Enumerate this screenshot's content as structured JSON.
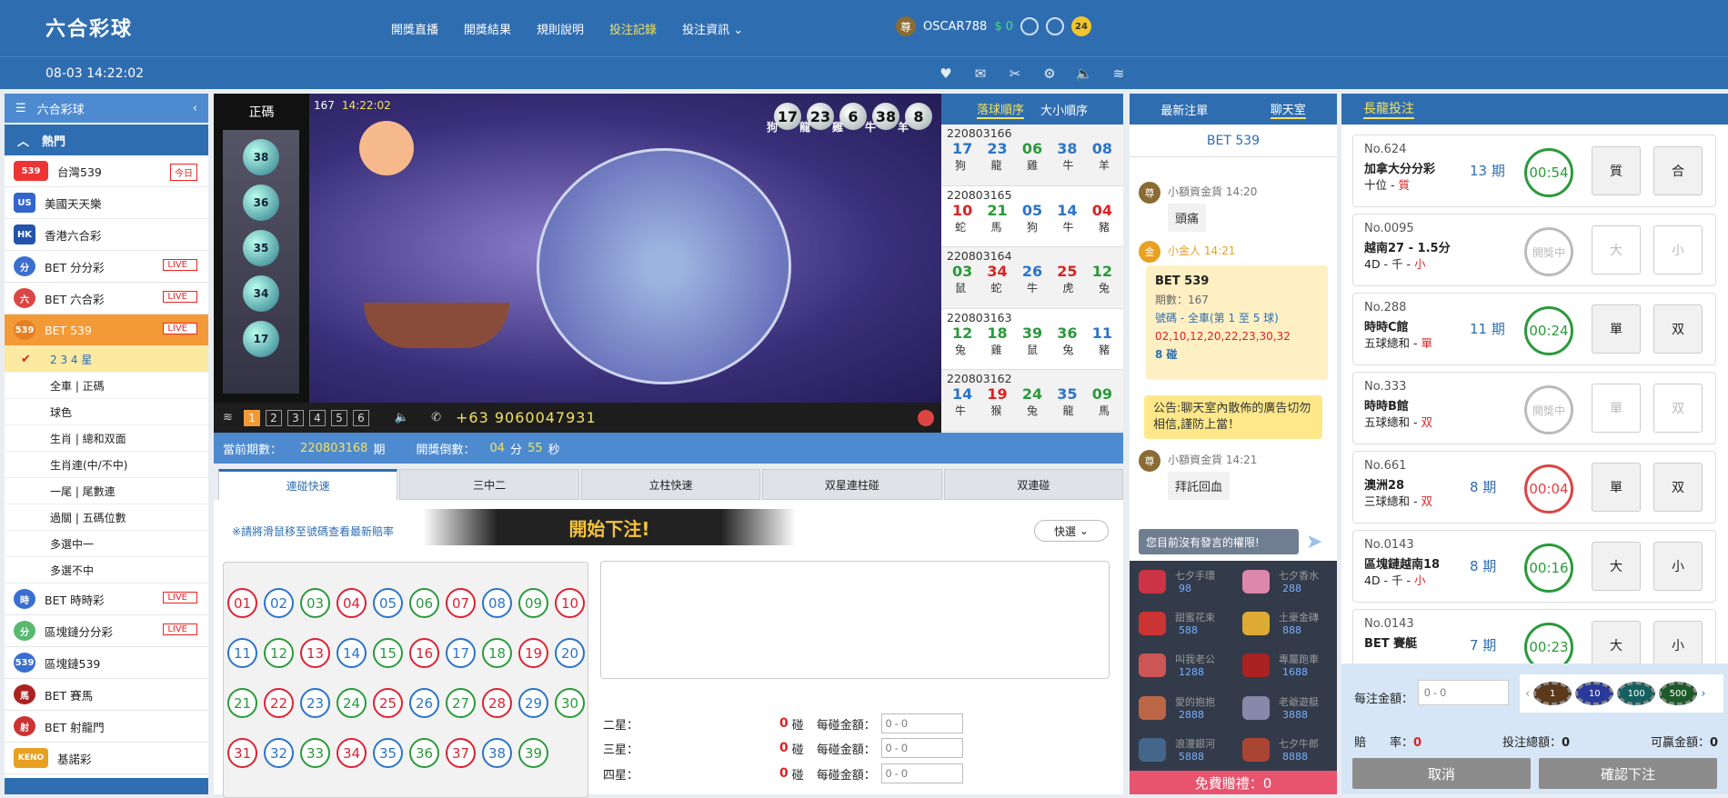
{
  "header": {
    "logo": "六合彩球",
    "nav": [
      "開獎直播",
      "開獎結果",
      "規則說明",
      "投注記錄",
      "投注資訊"
    ],
    "active_nav": 3,
    "avatar": "尊",
    "username": "OSCAR788",
    "balance": "$ 0",
    "badge": "24"
  },
  "subbar": {
    "datetime": "08-03 14:22:02"
  },
  "sidebar": {
    "title": "六合彩球",
    "hot": "熱門",
    "items": [
      {
        "label": "台灣539",
        "icon": "539",
        "tag": "今日"
      },
      {
        "label": "美國天天樂",
        "icon": "US"
      },
      {
        "label": "香港六合彩",
        "icon": "HK"
      },
      {
        "label": "BET 分分彩",
        "icon": "分",
        "live": "LIVE"
      },
      {
        "label": "BET 六合彩",
        "icon": "六",
        "live": "LIVE"
      },
      {
        "label": "BET 539",
        "icon": "539",
        "live": "LIVE"
      }
    ],
    "subitems": [
      "2 3 4 星",
      "全車 | 正碼",
      "球色",
      "生肖 | 總和双面",
      "生肖連(中/不中)",
      "一尾 | 尾數連",
      "過關 | 五碼位數",
      "多選中一",
      "多選不中"
    ],
    "items2": [
      {
        "label": "BET 時時彩",
        "icon": "時",
        "live": "LIVE"
      },
      {
        "label": "區塊鏈分分彩",
        "icon": "分",
        "live": "LIVE"
      },
      {
        "label": "區塊鏈539",
        "icon": "539"
      },
      {
        "label": "BET 賽馬",
        "icon": "馬"
      },
      {
        "label": "BET 射龍門",
        "icon": "射"
      },
      {
        "label": "基諾彩",
        "icon": "KENO"
      }
    ]
  },
  "video": {
    "tube_label": "正碼",
    "period": "167",
    "time": "14:22:02",
    "tube_balls": [
      "38",
      "36",
      "35",
      "34",
      "17"
    ],
    "balls": [
      {
        "n": "17",
        "z": "狗"
      },
      {
        "n": "23",
        "z": "龍"
      },
      {
        "n": "6",
        "z": "雞"
      },
      {
        "n": "38",
        "z": "牛"
      },
      {
        "n": "8",
        "z": "羊"
      }
    ],
    "pages": [
      "1",
      "2",
      "3",
      "4",
      "5",
      "6"
    ],
    "phone": "+63 9060047931"
  },
  "history": {
    "tabs": [
      "落球順序",
      "大小順序"
    ],
    "rows": [
      {
        "id": "220803166",
        "nums": [
          "17",
          "23",
          "06",
          "38",
          "08"
        ],
        "colors": [
          "blue",
          "blue",
          "green",
          "blue",
          "blue"
        ],
        "zod": [
          "狗",
          "龍",
          "雞",
          "牛",
          "羊"
        ]
      },
      {
        "id": "220803165",
        "nums": [
          "10",
          "21",
          "05",
          "14",
          "04"
        ],
        "colors": [
          "red",
          "green",
          "blue",
          "blue",
          "red"
        ],
        "zod": [
          "蛇",
          "馬",
          "狗",
          "牛",
          "豬"
        ]
      },
      {
        "id": "220803164",
        "nums": [
          "03",
          "34",
          "26",
          "25",
          "12"
        ],
        "colors": [
          "green",
          "red",
          "blue",
          "red",
          "green"
        ],
        "zod": [
          "鼠",
          "蛇",
          "牛",
          "虎",
          "兔"
        ]
      },
      {
        "id": "220803163",
        "nums": [
          "12",
          "18",
          "39",
          "36",
          "11"
        ],
        "colors": [
          "green",
          "green",
          "green",
          "green",
          "blue"
        ],
        "zod": [
          "兔",
          "雞",
          "鼠",
          "兔",
          "豬"
        ]
      },
      {
        "id": "220803162",
        "nums": [
          "14",
          "19",
          "24",
          "35",
          "09"
        ],
        "colors": [
          "blue",
          "red",
          "green",
          "blue",
          "green"
        ],
        "zod": [
          "牛",
          "猴",
          "兔",
          "龍",
          "馬"
        ]
      }
    ]
  },
  "info": {
    "cur_label": "當前期數：",
    "cur_period": "220803168",
    "period_unit": "期",
    "countdown_label": "開獎倒數：",
    "min": "04",
    "min_unit": "分",
    "sec": "55",
    "sec_unit": "秒"
  },
  "bet": {
    "tabs": [
      "連碰快速",
      "三中二",
      "立柱快速",
      "双星連柱碰",
      "双連碰"
    ],
    "hint": "※請將滑鼠移至號碼查看最新賠率",
    "start": "開始下注!",
    "quick": "快選",
    "numbers": [
      {
        "n": "01",
        "c": "red"
      },
      {
        "n": "02",
        "c": "blue"
      },
      {
        "n": "03",
        "c": "green"
      },
      {
        "n": "04",
        "c": "red"
      },
      {
        "n": "05",
        "c": "blue"
      },
      {
        "n": "06",
        "c": "green"
      },
      {
        "n": "07",
        "c": "red"
      },
      {
        "n": "08",
        "c": "blue"
      },
      {
        "n": "09",
        "c": "green"
      },
      {
        "n": "10",
        "c": "red"
      },
      {
        "n": "11",
        "c": "blue"
      },
      {
        "n": "12",
        "c": "green"
      },
      {
        "n": "13",
        "c": "red"
      },
      {
        "n": "14",
        "c": "blue"
      },
      {
        "n": "15",
        "c": "green"
      },
      {
        "n": "16",
        "c": "red"
      },
      {
        "n": "17",
        "c": "blue"
      },
      {
        "n": "18",
        "c": "green"
      },
      {
        "n": "19",
        "c": "red"
      },
      {
        "n": "20",
        "c": "blue"
      },
      {
        "n": "21",
        "c": "green"
      },
      {
        "n": "22",
        "c": "red"
      },
      {
        "n": "23",
        "c": "blue"
      },
      {
        "n": "24",
        "c": "green"
      },
      {
        "n": "25",
        "c": "red"
      },
      {
        "n": "26",
        "c": "blue"
      },
      {
        "n": "27",
        "c": "green"
      },
      {
        "n": "28",
        "c": "red"
      },
      {
        "n": "29",
        "c": "blue"
      },
      {
        "n": "30",
        "c": "green"
      },
      {
        "n": "31",
        "c": "red"
      },
      {
        "n": "32",
        "c": "blue"
      },
      {
        "n": "33",
        "c": "green"
      },
      {
        "n": "34",
        "c": "red"
      },
      {
        "n": "35",
        "c": "blue"
      },
      {
        "n": "36",
        "c": "green"
      },
      {
        "n": "37",
        "c": "red"
      },
      {
        "n": "38",
        "c": "blue"
      },
      {
        "n": "39",
        "c": "green"
      }
    ],
    "stars": [
      {
        "label": "二星：",
        "count": "0",
        "unit": "碰",
        "amt_label": "每碰金額：",
        "placeholder": "0 - 0"
      },
      {
        "label": "三星：",
        "count": "0",
        "unit": "碰",
        "amt_label": "每碰金額：",
        "placeholder": "0 - 0"
      },
      {
        "label": "四星：",
        "count": "0",
        "unit": "碰",
        "amt_label": "每碰金額：",
        "placeholder": "0 - 0"
      }
    ]
  },
  "chat": {
    "tabs": [
      "最新注單",
      "聊天室"
    ],
    "title": "BET 539",
    "m1": {
      "av": "尊",
      "name": "小額資金貨 14:20",
      "text": "頭痛"
    },
    "m2": {
      "av": "金",
      "name": "小金人 14:21"
    },
    "card": {
      "title": "BET 539",
      "period": "期數：167",
      "type": "號碼 - 全車(第 1 至 5 球)",
      "nums": "02,10,12,20,22,23,30,32",
      "hits": "8 碰"
    },
    "notice": "公告:聊天室內散佈的廣告切勿相信,謹防上當！",
    "m3": {
      "av": "尊",
      "name": "小額資金貨 14:21",
      "text": "拜託回血"
    },
    "nopost": "您目前沒有發言的權限!",
    "gifts": [
      {
        "n": "七夕手環",
        "p": "98"
      },
      {
        "n": "七夕香水",
        "p": "288"
      },
      {
        "n": "甜蜜花束",
        "p": "588"
      },
      {
        "n": "土豪金磚",
        "p": "888"
      },
      {
        "n": "叫我老公",
        "p": "1288"
      },
      {
        "n": "專屬跑車",
        "p": "1688"
      },
      {
        "n": "愛的抱抱",
        "p": "2888"
      },
      {
        "n": "老爺遊艇",
        "p": "3888"
      },
      {
        "n": "浪漫銀河",
        "p": "5888"
      },
      {
        "n": "七夕牛郎",
        "p": "8888"
      }
    ],
    "free": "免費贈禮：0"
  },
  "dragon": {
    "title": "長龍投注",
    "cards": [
      {
        "no": "No.624",
        "name": "加拿大分分彩",
        "desc": "十位 - ",
        "val": "質",
        "period": "13 期",
        "cd": "00:54",
        "st": "green",
        "b1": "質",
        "b2": "合",
        "dis": false
      },
      {
        "no": "No.0095",
        "name": "越南27 - 1.5分",
        "desc": "4D - 千 - ",
        "val": "小",
        "period": "",
        "cd": "開獎中",
        "st": "gray",
        "b1": "大",
        "b2": "小",
        "dis": true
      },
      {
        "no": "No.288",
        "name": "時時C館",
        "desc": "五球總和 - ",
        "val": "單",
        "period": "11 期",
        "cd": "00:24",
        "st": "green",
        "b1": "單",
        "b2": "双",
        "dis": false
      },
      {
        "no": "No.333",
        "name": "時時B館",
        "desc": "五球總和 - ",
        "val": "双",
        "period": "",
        "cd": "開獎中",
        "st": "gray",
        "b1": "單",
        "b2": "双",
        "dis": true
      },
      {
        "no": "No.661",
        "name": "澳洲28",
        "desc": "三球總和 - ",
        "val": "双",
        "period": "8 期",
        "cd": "00:04",
        "st": "red",
        "b1": "單",
        "b2": "双",
        "dis": false
      },
      {
        "no": "No.0143",
        "name": "區塊鏈越南18",
        "desc": "4D - 千 - ",
        "val": "小",
        "period": "8 期",
        "cd": "00:16",
        "st": "green",
        "b1": "大",
        "b2": "小",
        "dis": false
      },
      {
        "no": "No.0143",
        "name": "BET 賽艇",
        "desc": "",
        "val": "",
        "period": "7 期",
        "cd": "00:23",
        "st": "green",
        "b1": "大",
        "b2": "小",
        "dis": false
      }
    ],
    "amt_label": "每注金額：",
    "amt_placeholder": "0 - 0",
    "chips": [
      "1",
      "10",
      "100",
      "500"
    ],
    "odds_label": "賠　　率：",
    "odds": "0",
    "total_label": "投注總額：",
    "total": "0",
    "win_label": "可贏金額：",
    "win": "0",
    "cancel": "取消",
    "confirm": "確認下注"
  }
}
